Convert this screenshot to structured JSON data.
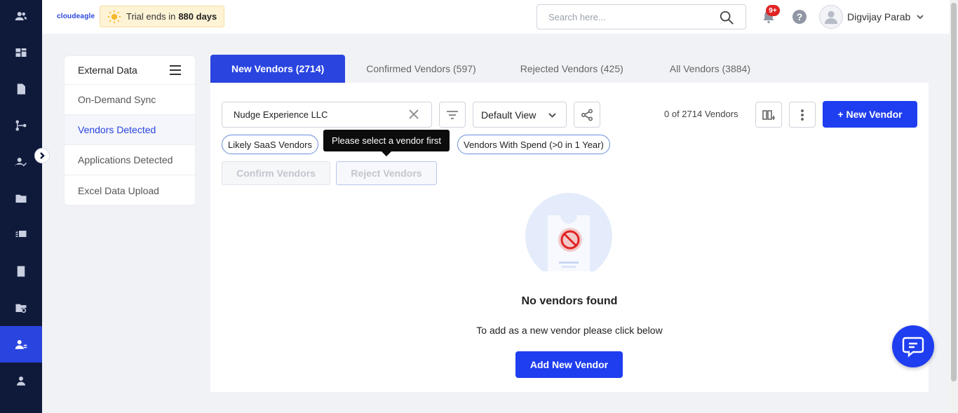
{
  "header": {
    "logo_text": "cloudeagle",
    "trial_prefix": "Trial ends in",
    "trial_days": "880 days",
    "search_placeholder": "Search here...",
    "notification_badge": "9+",
    "help_label": "?",
    "user_name": "Digvijay Parab"
  },
  "sidebar": {
    "title": "External Data",
    "items": [
      {
        "label": "On-Demand Sync",
        "active": false
      },
      {
        "label": "Vendors Detected",
        "active": true
      },
      {
        "label": "Applications Detected",
        "active": false
      },
      {
        "label": "Excel Data Upload",
        "active": false
      }
    ]
  },
  "tabs": [
    {
      "label": "New Vendors (2714)",
      "active": true
    },
    {
      "label": "Confirmed Vendors (597)",
      "active": false
    },
    {
      "label": "Rejected Vendors (425)",
      "active": false
    },
    {
      "label": "All Vendors (3884)",
      "active": false
    }
  ],
  "toolbar": {
    "search_value": "Nudge Experience LLC",
    "view_select": "Default View",
    "vendor_count": "0 of 2714 Vendors",
    "new_vendor_label": "+ New Vendor"
  },
  "chips": [
    "Likely SaaS Vendors",
    "Vendors With Spend (>0 in 1 Year)"
  ],
  "tooltip": "Please select a vendor first",
  "actions": {
    "confirm_label": "Confirm Vendors",
    "reject_label": "Reject Vendors"
  },
  "empty_state": {
    "title": "No vendors found",
    "subtitle": "To add as a new vendor please click below",
    "button_label": "Add New Vendor"
  },
  "colors": {
    "brand": "#1f3ef0",
    "rail": "#0f1a3b",
    "badge": "#e02424"
  }
}
